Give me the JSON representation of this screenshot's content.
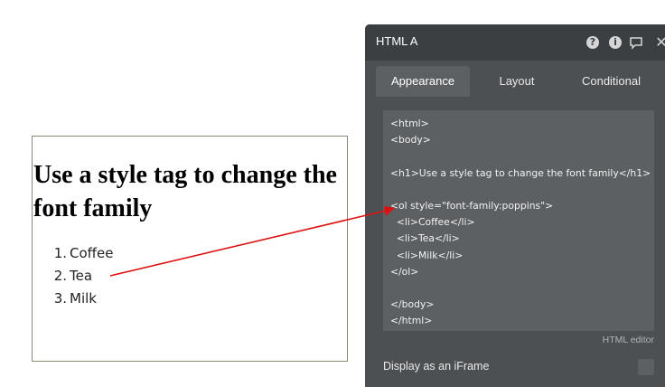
{
  "preview": {
    "heading": "Use a style tag to change the font family",
    "list": [
      {
        "num": "1.",
        "text": "Coffee"
      },
      {
        "num": "2.",
        "text": "Tea"
      },
      {
        "num": "3.",
        "text": "Milk"
      }
    ]
  },
  "panel": {
    "title": "HTML A",
    "icons": [
      "question-icon",
      "info-icon",
      "comment-icon",
      "close-icon"
    ],
    "tabs": [
      "Appearance",
      "Layout",
      "Conditional"
    ],
    "active_tab": "Appearance",
    "code": "<html>\n<body>\n\n<h1>Use a style tag to change the font family</h1>\n\n<ol style=\"font-family:poppins\">\n  <li>Coffee</li>\n  <li>Tea</li>\n  <li>Milk</li>\n</ol>\n\n</body>\n</html>",
    "editor_label": "HTML editor",
    "iframe_label": "Display as an iFrame",
    "iframe_checked": false
  },
  "colors": {
    "arrow": "#dd1111",
    "panel_bg": "#4d5053",
    "header_bg": "#3c3f41",
    "editor_bg": "#5d6063"
  }
}
